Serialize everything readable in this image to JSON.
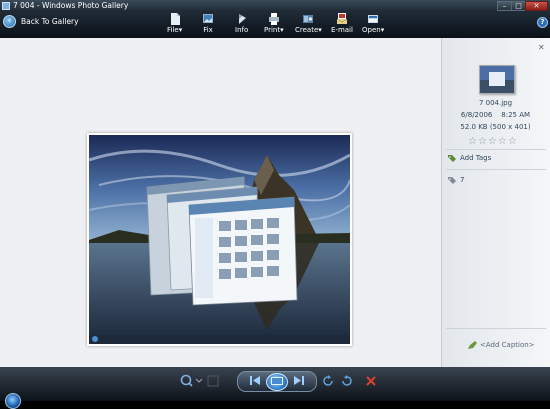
{
  "window": {
    "title": "7 004 - Windows Photo Gallery"
  },
  "toolbar": {
    "back_label": "Back To Gallery",
    "items": [
      {
        "label": "File",
        "icon": "file-icon",
        "has_menu": true
      },
      {
        "label": "Fix",
        "icon": "fix-icon",
        "has_menu": false
      },
      {
        "label": "Info",
        "icon": "info-icon",
        "has_menu": false
      },
      {
        "label": "Print",
        "icon": "print-icon",
        "has_menu": true
      },
      {
        "label": "Create",
        "icon": "create-icon",
        "has_menu": true
      },
      {
        "label": "E-mail",
        "icon": "email-icon",
        "has_menu": false
      },
      {
        "label": "Open",
        "icon": "open-icon",
        "has_menu": true
      }
    ]
  },
  "info_pane": {
    "filename": "7 004.jpg",
    "date": "6/8/2006",
    "time": "8:25 AM",
    "size": "52.0 KB (500 x 401)",
    "rating": 0,
    "add_tags_label": "Add Tags",
    "tag": "7",
    "caption_placeholder": "<Add Caption>"
  },
  "colors": {
    "toolbar_bg": "#0a1118",
    "content_bg": "#eef0f3",
    "pane_bg": "#f4f6f8",
    "accent_blue": "#2d6fb5"
  }
}
